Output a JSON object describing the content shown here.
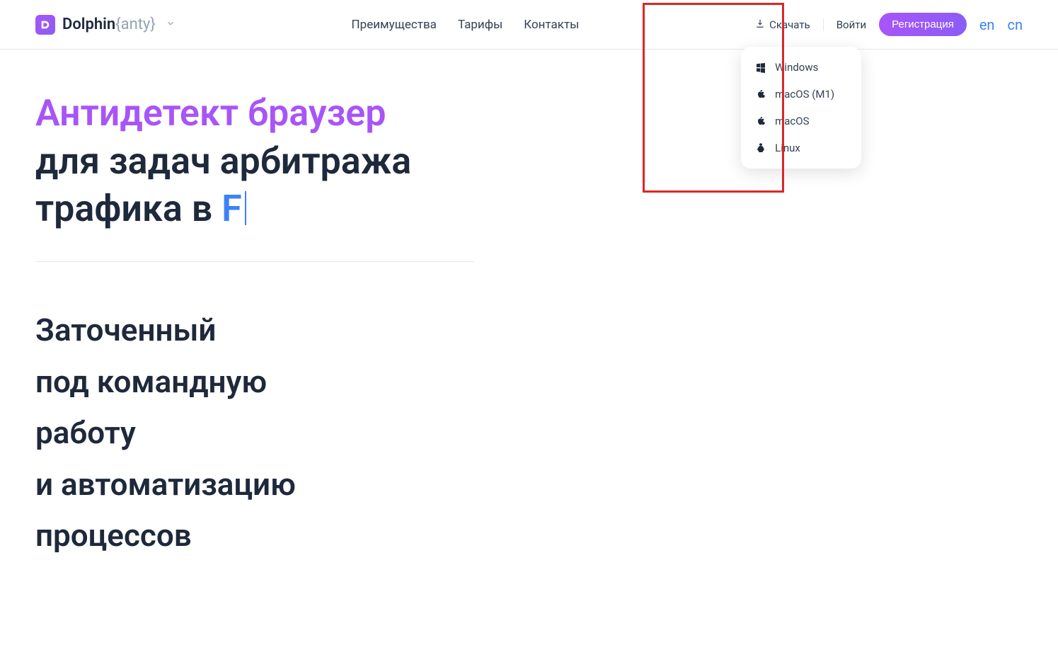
{
  "header": {
    "logo_prefix": "Dolphin",
    "logo_suffix": "{anty}",
    "nav": {
      "advantages": "Преимущества",
      "pricing": "Тарифы",
      "contacts": "Контакты"
    },
    "download": "Скачать",
    "login": "Войти",
    "register": "Регистрация",
    "lang_en": "en",
    "lang_cn": "cn"
  },
  "download_menu": {
    "windows": "Windows",
    "macos_m1": "macOS (M1)",
    "macos": "macOS",
    "linux": "Linux"
  },
  "hero": {
    "title_purple": "Антидетект браузер",
    "title_line2a": "для задач арбитража",
    "title_line2b_prefix": "трафика в ",
    "typed_char": "F",
    "sub_line1": "Заточенный",
    "sub_line2": "под командную",
    "sub_line3": "работу",
    "sub_line4": "и автоматизацию",
    "sub_line5": "процессов"
  }
}
